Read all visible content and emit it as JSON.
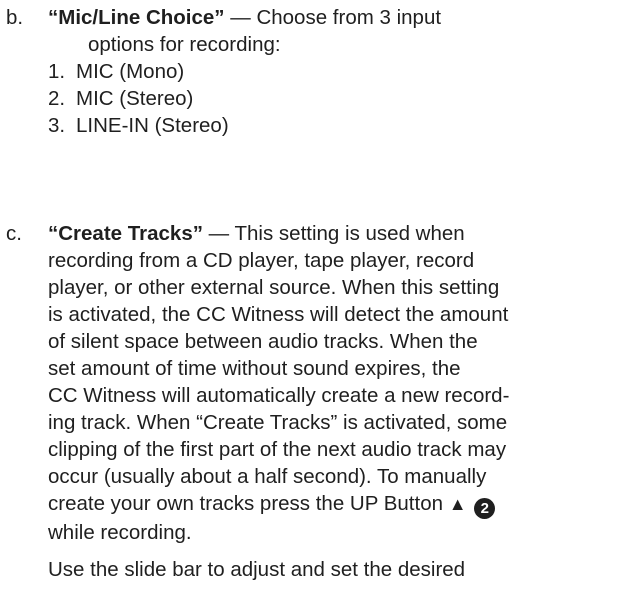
{
  "item_b": {
    "marker": "b.",
    "title": "“Mic/Line Choice”",
    "intro_line1": " — Choose from 3 input",
    "intro_line2": "options for recording:",
    "options": [
      {
        "num": "1.",
        "label": "MIC (Mono)"
      },
      {
        "num": "2.",
        "label": "MIC (Stereo)"
      },
      {
        "num": "3.",
        "label": "LINE-IN (Stereo)"
      }
    ]
  },
  "item_c": {
    "marker": "c.",
    "title": "“Create Tracks”",
    "lines": [
      " — This setting is used when",
      "recording from a CD player, tape player, record",
      "player, or other external source. When this setting",
      "is activated, the CC Witness will detect the amount",
      "of silent space between audio tracks. When the",
      "set amount of time without sound expires, the",
      "CC Witness will automatically create a new record-",
      "ing track. When “Create Tracks” is activated, some",
      "clipping of the first part of the next audio track may",
      "occur (usually about a half second). To manually",
      "create your own tracks press the UP Button "
    ],
    "up_arrow": "▲",
    "button_number": "2",
    "last_line": "while recording.",
    "para2_line1": "Use the slide bar to adjust and set the desired"
  },
  "icons": {
    "up_arrow": "up-triangle-icon",
    "button_number": "circled-number-icon"
  }
}
